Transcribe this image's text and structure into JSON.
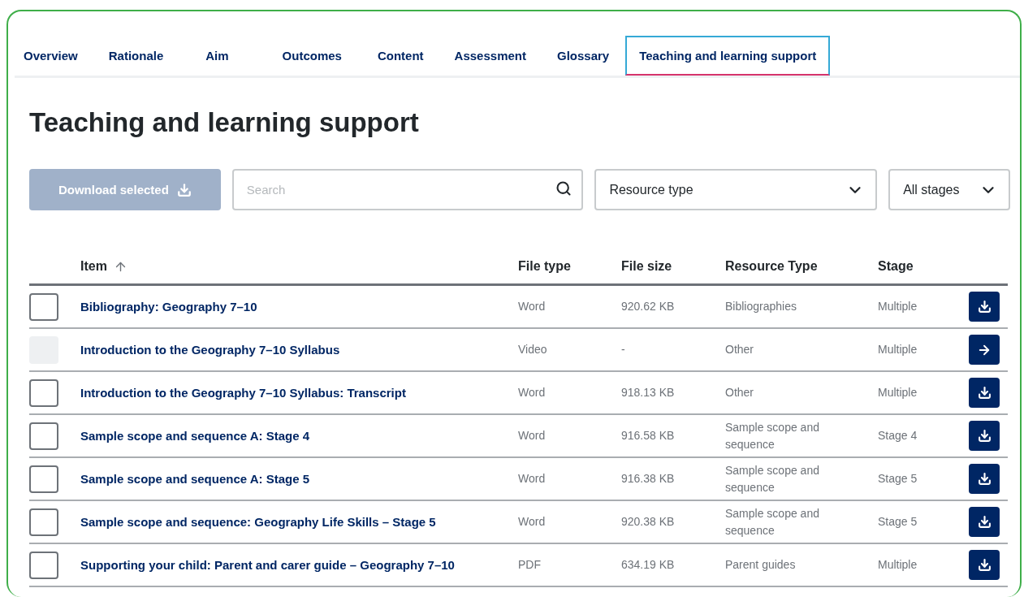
{
  "tabs": [
    {
      "label": "Overview",
      "selected": false
    },
    {
      "label": "Rationale",
      "selected": false
    },
    {
      "label": "Aim",
      "selected": false
    },
    {
      "label": "Outcomes",
      "selected": false
    },
    {
      "label": "Content",
      "selected": false
    },
    {
      "label": "Assessment",
      "selected": false
    },
    {
      "label": "Glossary",
      "selected": false
    },
    {
      "label": "Teaching and learning support",
      "selected": true
    }
  ],
  "heading": "Teaching and learning support",
  "toolbar": {
    "download_button": {
      "label": "Download selected",
      "disabled": true
    },
    "search": {
      "placeholder": "Search"
    },
    "resource_type": {
      "value": "Resource type"
    },
    "stage": {
      "value": "All stages"
    }
  },
  "table": {
    "columns": [
      {
        "label": "Item",
        "sorted": true
      },
      {
        "label": "File type",
        "sorted": false
      },
      {
        "label": "File size",
        "sorted": false
      },
      {
        "label": "Resource Type",
        "sorted": false
      },
      {
        "label": "Stage",
        "sorted": false
      }
    ],
    "rows": [
      {
        "item": "Bibliography: Geography 7–10",
        "file_type": "Word",
        "file_size": "920.62 KB",
        "resource_type": "Bibliographies",
        "stage": "Multiple",
        "checked": false,
        "disabled": false,
        "kind": "download"
      },
      {
        "item": "Introduction to the Geography 7–10 Syllabus",
        "file_type": "Video",
        "file_size": "-",
        "resource_type": "Other",
        "stage": "Multiple",
        "checked": false,
        "disabled": true,
        "kind": "link"
      },
      {
        "item": "Introduction to the Geography 7–10 Syllabus: Transcript",
        "file_type": "Word",
        "file_size": "918.13 KB",
        "resource_type": "Other",
        "stage": "Multiple",
        "checked": false,
        "disabled": false,
        "kind": "download"
      },
      {
        "item": "Sample scope and sequence A: Stage 4",
        "file_type": "Word",
        "file_size": "916.58 KB",
        "resource_type": "Sample scope and sequence",
        "stage": "Stage 4",
        "checked": false,
        "disabled": false,
        "kind": "download"
      },
      {
        "item": "Sample scope and sequence A: Stage 5",
        "file_type": "Word",
        "file_size": "916.38 KB",
        "resource_type": "Sample scope and sequence",
        "stage": "Stage 5",
        "checked": false,
        "disabled": false,
        "kind": "download"
      },
      {
        "item": "Sample scope and sequence: Geography Life Skills – Stage 5",
        "file_type": "Word",
        "file_size": "920.38 KB",
        "resource_type": "Sample scope and sequence",
        "stage": "Stage 5",
        "checked": false,
        "disabled": false,
        "kind": "download"
      },
      {
        "item": "Supporting your child: Parent and carer guide – Geography 7–10",
        "file_type": "PDF",
        "file_size": "634.19 KB",
        "resource_type": "Parent guides",
        "stage": "Multiple",
        "checked": false,
        "disabled": false,
        "kind": "download"
      }
    ]
  }
}
